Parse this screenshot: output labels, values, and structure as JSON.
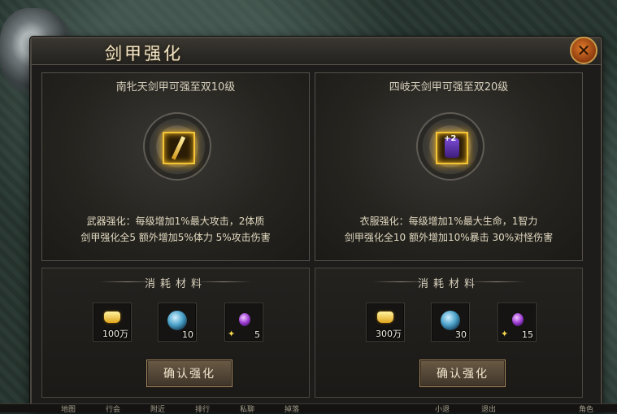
{
  "window": {
    "title": "剑甲强化",
    "close_label": "✕"
  },
  "left_panel": {
    "title": "南牝天剑甲可强至双10级",
    "desc_line1": "武器强化：每级增加1%最大攻击，2体质",
    "desc_line2": "剑甲强化全5  额外增加5%体力  5%攻击伤害",
    "materials_title": "消耗材料",
    "materials": [
      {
        "icon": "gold-ingot-icon",
        "qty": "100万"
      },
      {
        "icon": "blue-orb-icon",
        "qty": "10"
      },
      {
        "icon": "purple-gem-icon",
        "qty": "5"
      }
    ],
    "confirm_label": "确认强化"
  },
  "right_panel": {
    "title": "四岐天剑甲可强至双20级",
    "item_plus": "+2",
    "desc_line1": "衣服强化：每级增加1%最大生命，1智力",
    "desc_line2": "剑甲强化全10  额外增加10%暴击  30%对怪伤害",
    "materials_title": "消耗材料",
    "materials": [
      {
        "icon": "gold-ingot-icon",
        "qty": "300万"
      },
      {
        "icon": "blue-orb-icon",
        "qty": "30"
      },
      {
        "icon": "purple-gem-icon",
        "qty": "15"
      }
    ],
    "confirm_label": "确认强化"
  },
  "side_mark": "I",
  "bottom_bar": [
    "地图",
    "行会",
    "附近",
    "排行",
    "私聊",
    "掉落",
    "小退",
    "退出",
    "角色"
  ],
  "colors": {
    "accent": "#f3c435",
    "close": "#e07b2a",
    "frame": "#4b4740"
  }
}
